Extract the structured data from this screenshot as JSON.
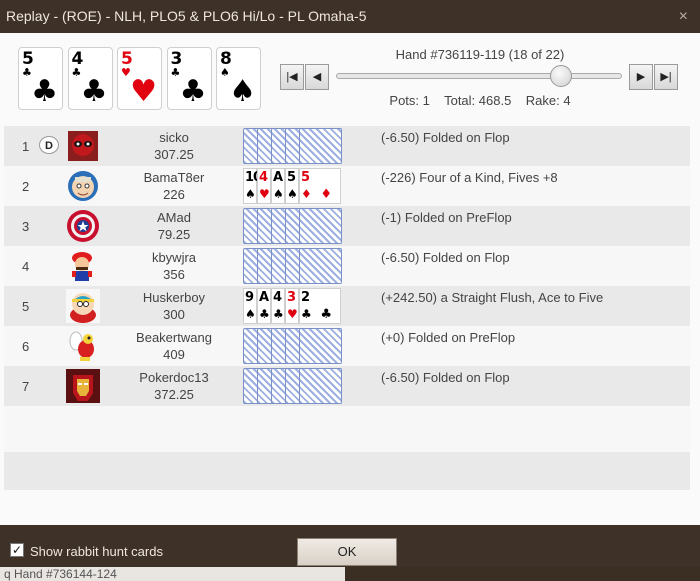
{
  "window": {
    "title": "Replay - (ROE) - NLH, PLO5 & PLO6 Hi/Lo - PL Omaha-5",
    "close_icon": "×"
  },
  "board": [
    {
      "rank": "5",
      "suit": "♣",
      "color": "black"
    },
    {
      "rank": "4",
      "suit": "♣",
      "color": "black"
    },
    {
      "rank": "5",
      "suit": "♥",
      "color": "red"
    },
    {
      "rank": "3",
      "suit": "♣",
      "color": "black"
    },
    {
      "rank": "8",
      "suit": "♠",
      "color": "black"
    }
  ],
  "hand": {
    "label": "Hand #736119-119 (18 of 22)",
    "pots_label": "Pots: 1",
    "total_label": "Total: 468.5",
    "rake_label": "Rake: 4",
    "progress": 0.81
  },
  "nav": {
    "first_icon": "|◀",
    "prev_icon": "◀",
    "next_icon": "▶",
    "last_icon": "▶|"
  },
  "players": [
    {
      "seat": "1",
      "dealer": "D",
      "name": "sicko",
      "stack": "307.25",
      "avatar": "deadpool-avatar",
      "result": "(-6.50) Folded on Flop",
      "cards": null
    },
    {
      "seat": "2",
      "dealer": "",
      "name": "BamaT8er",
      "stack": "226",
      "avatar": "cartoon-face-avatar",
      "result": "(-226) Four of a Kind, Fives +8",
      "cards": [
        {
          "r": "10",
          "s": "♠",
          "c": "black"
        },
        {
          "r": "4",
          "s": "♥",
          "c": "red"
        },
        {
          "r": "A",
          "s": "♠",
          "c": "black"
        },
        {
          "r": "5",
          "s": "♠",
          "c": "black"
        },
        {
          "r": "5",
          "s": "♦",
          "c": "red"
        }
      ]
    },
    {
      "seat": "3",
      "dealer": "",
      "name": "AMad",
      "stack": "79.25",
      "avatar": "captain-america-shield-avatar",
      "result": "(-1) Folded on PreFlop",
      "cards": null
    },
    {
      "seat": "4",
      "dealer": "",
      "name": "kbywjra",
      "stack": "356",
      "avatar": "mario-avatar",
      "result": "(-6.50) Folded on Flop",
      "cards": null
    },
    {
      "seat": "5",
      "dealer": "",
      "name": "Huskerboy",
      "stack": "300",
      "avatar": "cartman-avatar",
      "result": "(+242.50) a Straight Flush, Ace to Five",
      "cards": [
        {
          "r": "9",
          "s": "♠",
          "c": "black"
        },
        {
          "r": "A",
          "s": "♣",
          "c": "black"
        },
        {
          "r": "4",
          "s": "♣",
          "c": "black"
        },
        {
          "r": "3",
          "s": "♥",
          "c": "red"
        },
        {
          "r": "2",
          "s": "♣",
          "c": "black"
        }
      ]
    },
    {
      "seat": "6",
      "dealer": "",
      "name": "Beakertwang",
      "stack": "409",
      "avatar": "koopa-paratroopa-avatar",
      "result": "(+0) Folded on PreFlop",
      "cards": null
    },
    {
      "seat": "7",
      "dealer": "",
      "name": "Pokerdoc13",
      "stack": "372.25",
      "avatar": "iron-man-avatar",
      "result": "(-6.50) Folded on Flop",
      "cards": null
    }
  ],
  "footer": {
    "checkbox_checked": true,
    "checkbox_label": "Show rabbit hunt cards",
    "ok_label": "OK",
    "behind_text": "q Hand #736144-124"
  },
  "colors": {
    "frame": "#3d3128",
    "row_alt": "#e9e9e9",
    "red_suit": "#e00010"
  }
}
